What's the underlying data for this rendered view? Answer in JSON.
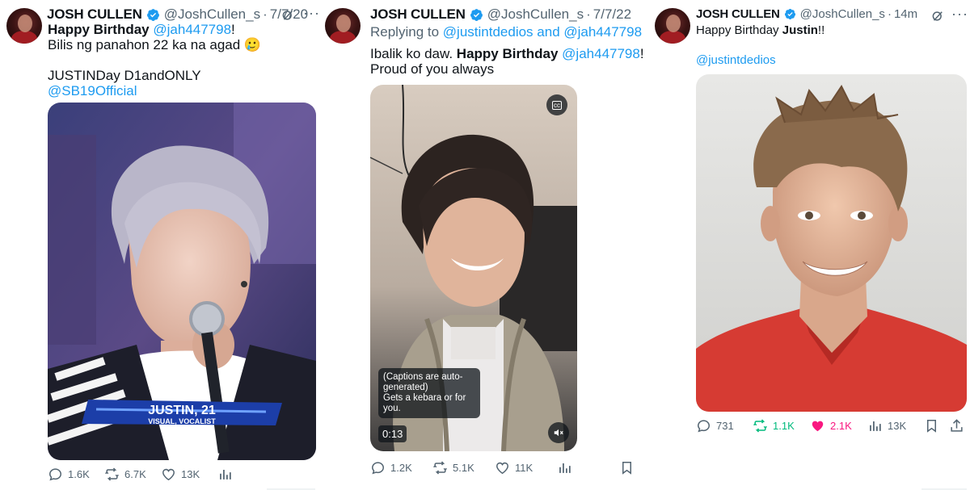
{
  "tweets": [
    {
      "name": "JOSH CULLEN",
      "handle": "@JoshCullen_s",
      "sep": "·",
      "time": "7/7/20",
      "line1_bold": "Happy Birthday",
      "line1_mention": "@jah447798",
      "line1_end": "!",
      "line2": "Bilis ng panahon 22 ka na agad 🥲",
      "line3": "JUSTINDay D1andONLY",
      "line4": "@SB19Official",
      "media_caption_name": "JUSTIN, 21",
      "media_caption_sub": "VISUAL, VOCALIST",
      "replies": "1.6K",
      "reposts": "6.7K",
      "likes": "13K",
      "icons": [
        "grok-icon",
        "more-icon",
        "reply-icon",
        "repost-icon",
        "like-icon",
        "views-icon"
      ]
    },
    {
      "name": "JOSH CULLEN",
      "handle": "@JoshCullen_s",
      "sep": "·",
      "time": "7/7/22",
      "replying_prefix": "Replying to",
      "replying_to": "@justintdedios and @jah447798",
      "line1_start": "Ibalik ko daw.",
      "line1_bold": "Happy Birthday",
      "line1_mention": "@jah447798",
      "line1_end": "!",
      "line2": "Proud of you always",
      "captions_line1": "(Captions are auto-",
      "captions_line2": "generated)",
      "captions_line3": "Gets a kebara or for",
      "captions_line4": "you.",
      "video_time": "0:13",
      "cc_label": "cc",
      "replies": "1.2K",
      "reposts": "5.1K",
      "likes": "11K",
      "icons": [
        "cc-icon",
        "mute-icon",
        "reply-icon",
        "repost-icon",
        "like-icon",
        "views-icon",
        "bookmark-icon"
      ]
    },
    {
      "name": "JOSH CULLEN",
      "handle": "@JoshCullen_s",
      "sep": "·",
      "time": "14m",
      "line1_start": "Happy Birthday",
      "line1_bold": "Justin",
      "line1_end": "!!",
      "line2": "@justintdedios",
      "replies": "731",
      "reposts": "1.1K",
      "likes": "2.1K",
      "views": "13K",
      "icons": [
        "grok-icon",
        "more-icon",
        "reply-icon",
        "repost-icon",
        "like-filled-icon",
        "views-icon",
        "bookmark-icon",
        "share-icon"
      ]
    }
  ],
  "colors": {
    "link": "#1d9bf0",
    "text": "#0f1419",
    "muted": "#536471",
    "repost_active": "#00ba7c",
    "like_active": "#f91880",
    "verified": "#1d9bf0"
  }
}
